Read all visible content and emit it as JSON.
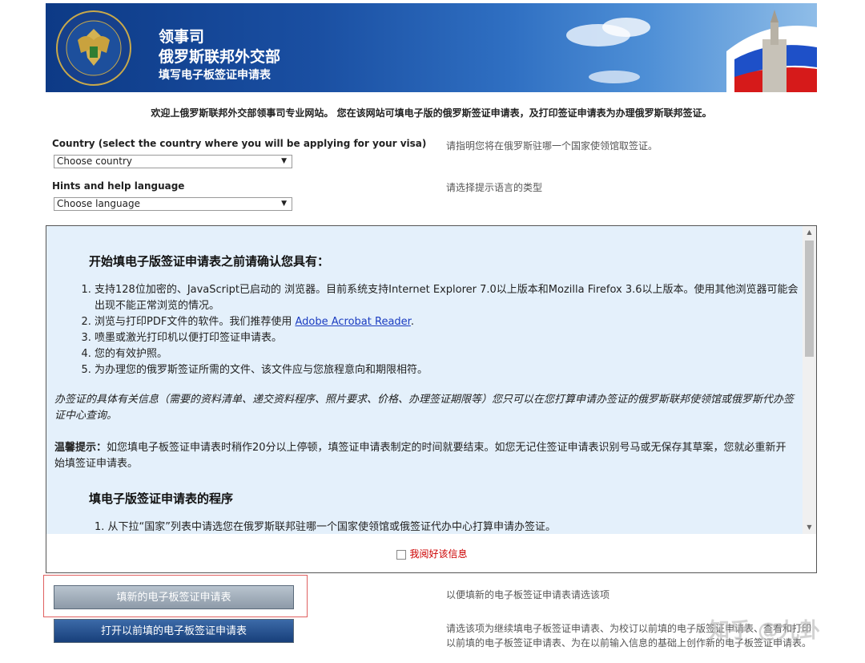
{
  "header": {
    "line1": "领事司",
    "line2": "俄罗斯联邦外交部",
    "line3": "填写电子板签证申请表"
  },
  "welcome": "欢迎上俄罗斯联邦外交部领事司专业网站。 您在该网站可填电子版的俄罗斯签证申请表，及打印签证申请表为办理俄罗斯联邦签证。",
  "country": {
    "label": "Country (select the country where you will be applying for your visa)",
    "selected": "Choose country",
    "hint": "请指明您将在俄罗斯驻哪一个国家使领馆取签证。"
  },
  "language": {
    "label": "Hints and help language",
    "selected": "Choose language",
    "hint": "请选择提示语言的类型"
  },
  "panel": {
    "heading1": "开始填电子版签证申请表之前请确认您具有：",
    "items": [
      "支持128位加密的、JavaScript已启动的 浏览器。目前系统支持Internet Explorer 7.0以上版本和Mozilla Firefox 3.6以上版本。使用其他浏览器可能会出现不能正常浏览的情况。",
      "浏览与打印PDF文件的软件。我们推荐使用 ",
      "喷墨或激光打印机以便打印签证申请表。",
      "您的有效护照。",
      "为办理您的俄罗斯签证所需的文件、该文件应与您旅程意向和期限相符。"
    ],
    "link_text": "Adobe Acrobat Reader",
    "italic_note": "办签证的具体有关信息（需要的资料清单、递交资料程序、照片要求、价格、办理签证期限等）您只可以在您打算申请办签证的俄罗斯联邦使领馆或俄罗斯代办签证中心查询。",
    "tip_label": "温馨提示：",
    "tip_text": "如您填电子板签证申请表时稍作20分以上停顿，填签证申请表制定的时间就要结束。如您无记住签证申请表识别号马或无保存其草案，您就必重新开始填签证申请表。",
    "heading2": "填电子版签证申请表的程序",
    "procedure_first": "从下拉“国家”列表中请选您在俄罗斯联邦驻哪一个国家使领馆或俄签证代办中心打算申请办签证。",
    "confirm_label": "我阅好该信息"
  },
  "buttons": {
    "new_label": "填新的电子板签证申请表",
    "new_hint": "以便填新的电子板签证申请表请选该项",
    "open_label": "打开以前填的电子板签证申请表",
    "open_hint": "请选该项为继续填电子板签证申请表、为校订以前填的电子版签证申请表、查看和打印以前填的电子板签证申请表、为在以前输入信息的基础上创作新的电子板签证申请表。"
  },
  "watermark": "知乎 @九卦",
  "colors": {
    "banner": "#1a4fa2",
    "panel_bg": "#e4f0fb",
    "confirm_red": "#cc0000",
    "link_blue": "#1a3cc1"
  }
}
